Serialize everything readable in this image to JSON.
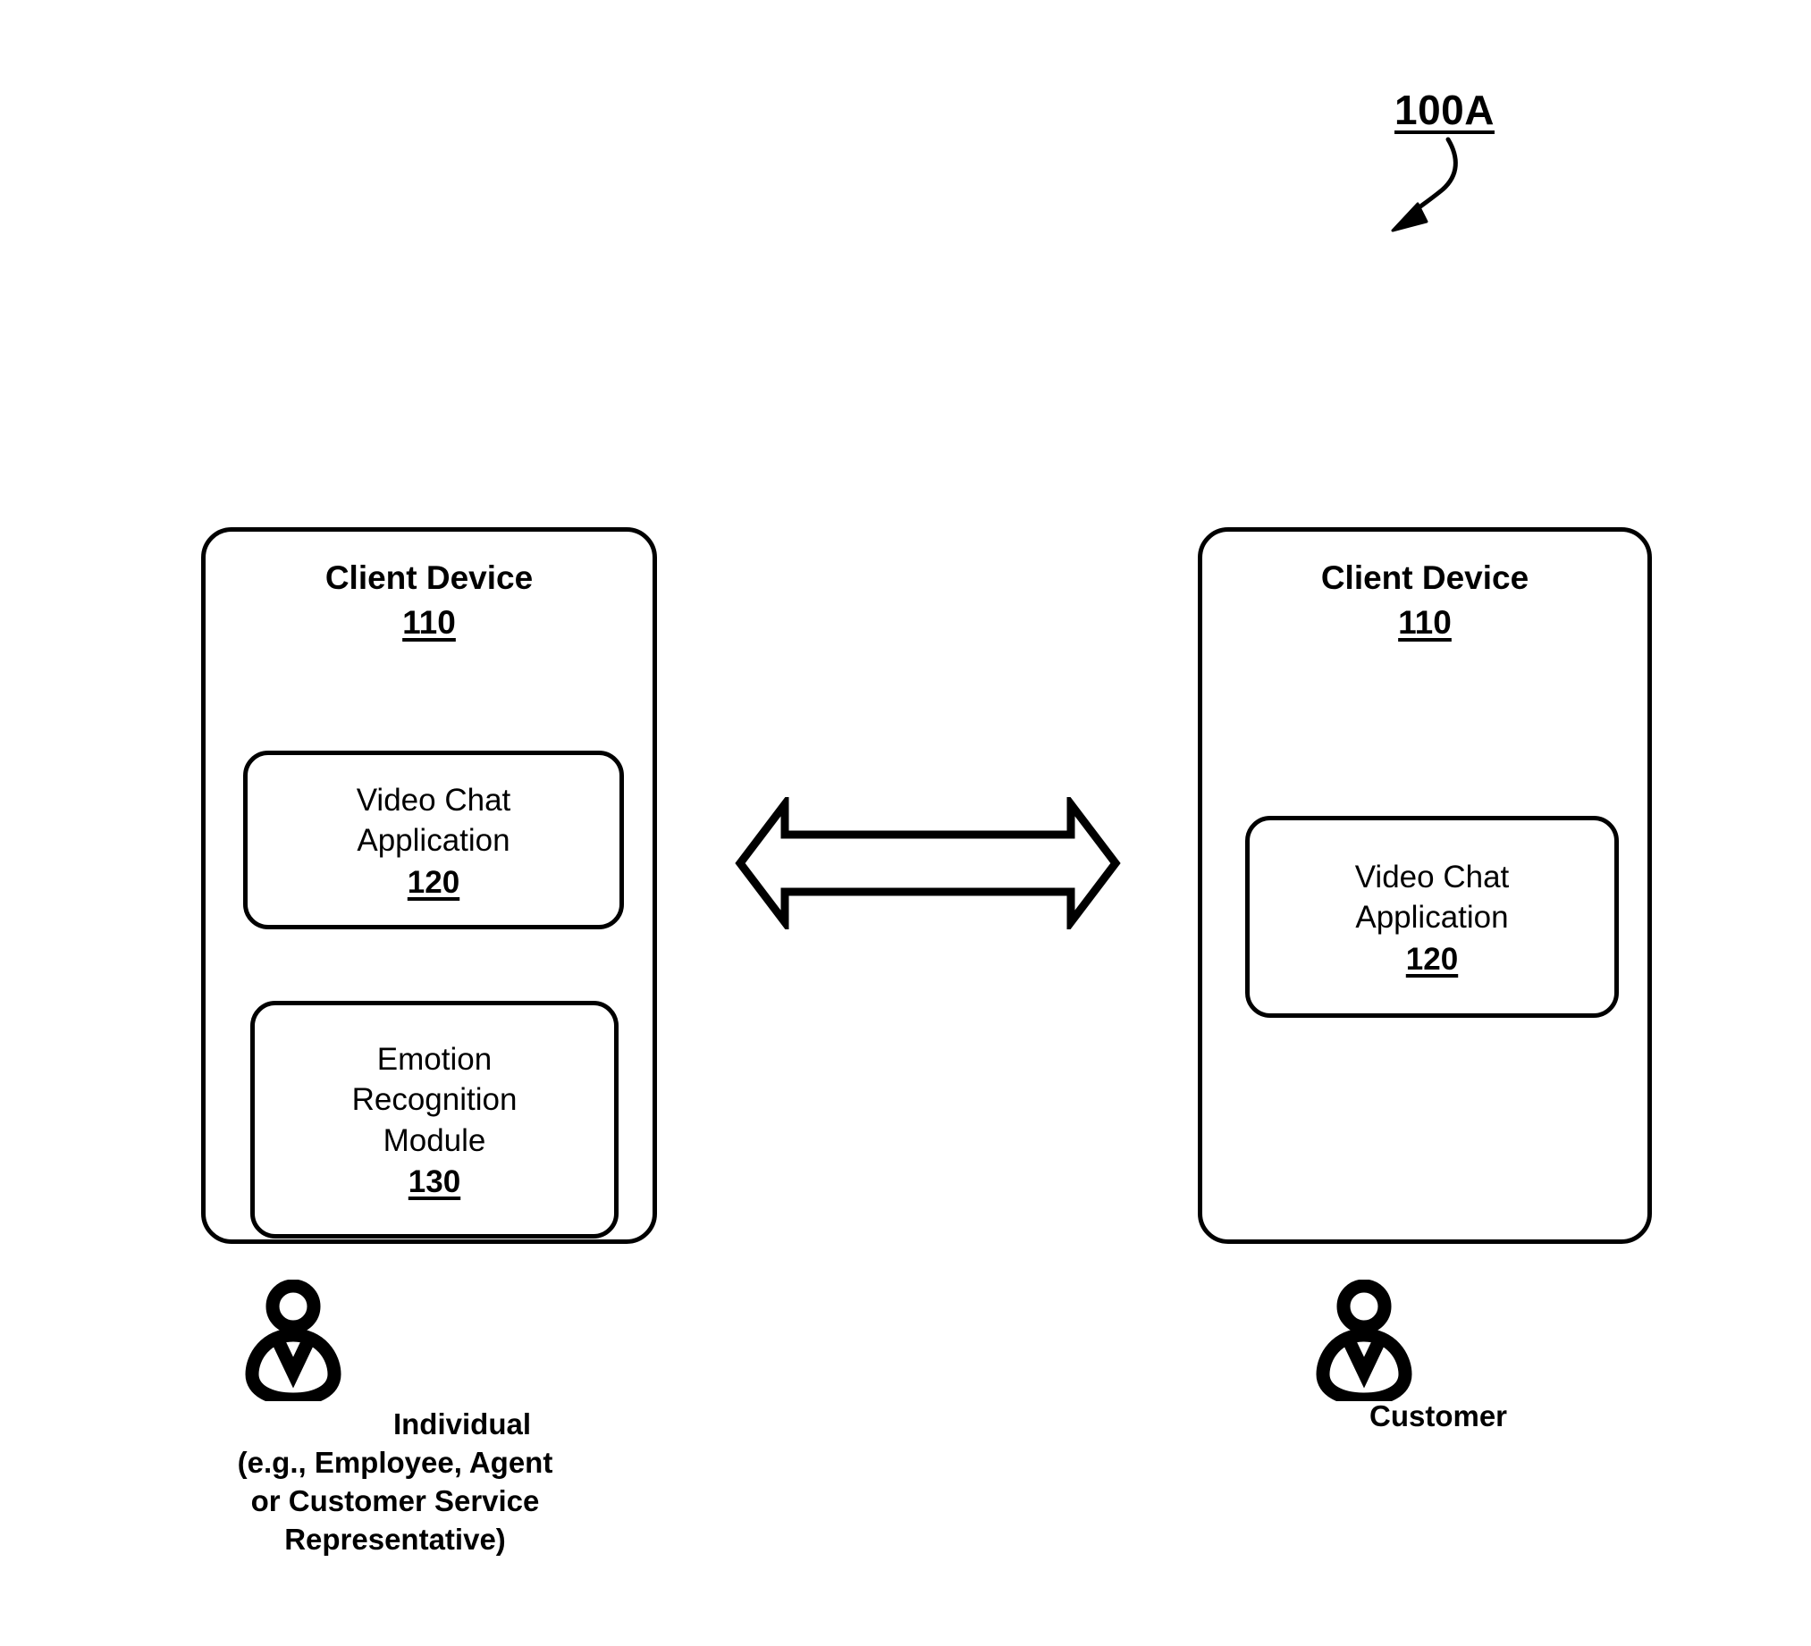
{
  "figure": {
    "reference_label": "100A",
    "callout_icon": "curved-arrow-icon"
  },
  "nodes": {
    "left_device": {
      "title": "Client Device",
      "reference": "110",
      "modules": [
        {
          "label": "Video Chat\nApplication",
          "reference": "120",
          "name": "video-chat-application"
        },
        {
          "label": "Emotion\nRecognition\nModule",
          "reference": "130",
          "name": "emotion-recognition-module"
        }
      ]
    },
    "right_device": {
      "title": "Client Device",
      "reference": "110",
      "modules": [
        {
          "label": "Video Chat\nApplication",
          "reference": "120",
          "name": "video-chat-application"
        }
      ]
    }
  },
  "connector": {
    "icon": "double-headed-arrow-icon",
    "style": "hollow-outline",
    "direction": "bidirectional"
  },
  "actors": {
    "left": {
      "icon": "person-icon",
      "caption_first_line": "Individual",
      "caption_rest": "(e.g., Employee, Agent\nor Customer Service\nRepresentative)"
    },
    "right": {
      "icon": "person-icon",
      "caption": "Customer"
    }
  },
  "colors": {
    "stroke": "#000000",
    "background": "#ffffff",
    "text": "#000000"
  }
}
